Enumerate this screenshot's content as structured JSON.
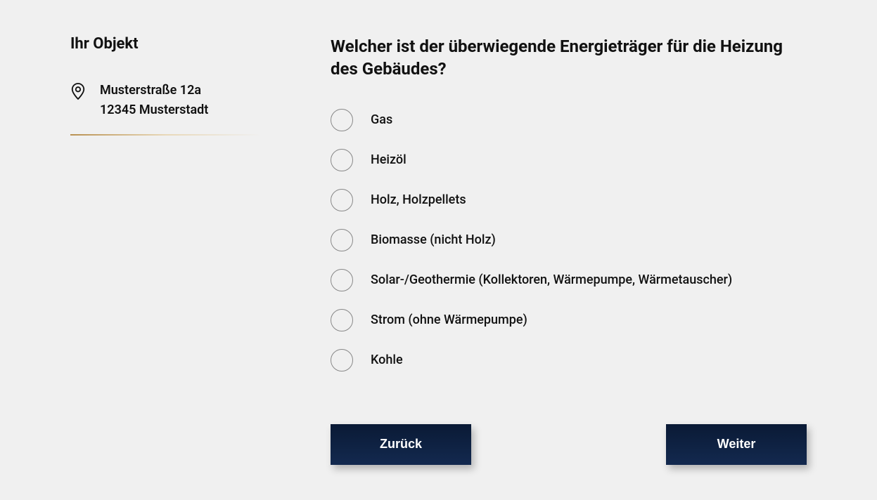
{
  "sidebar": {
    "title": "Ihr Objekt",
    "address_line1": "Musterstraße 12a",
    "address_line2": "12345 Musterstadt"
  },
  "main": {
    "question": "Welcher ist der überwiegende Energieträger für die Heizung des Gebäudes?",
    "options": [
      {
        "label": "Gas"
      },
      {
        "label": "Heizöl"
      },
      {
        "label": "Holz, Holzpellets"
      },
      {
        "label": "Biomasse (nicht Holz)"
      },
      {
        "label": "Solar-/Geothermie (Kollektoren, Wärmepumpe, Wärmetauscher)"
      },
      {
        "label": "Strom (ohne Wärmepumpe)"
      },
      {
        "label": "Kohle"
      }
    ],
    "back_label": "Zurück",
    "next_label": "Weiter"
  }
}
